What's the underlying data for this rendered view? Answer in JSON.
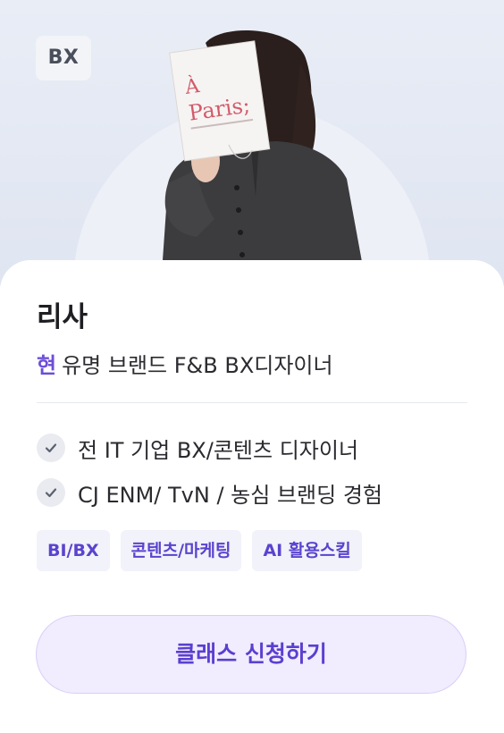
{
  "hero": {
    "badge": "BX",
    "book_title_line1": "À",
    "book_title_line2": "Paris;",
    "photo_icon": "person-holding-book"
  },
  "profile": {
    "name": "리사",
    "role_prefix": "현",
    "role": "유명 브랜드 F&B BX디자이너",
    "career": [
      "전 IT 기업 BX/콘텐츠 디자이너",
      "CJ ENM/ TvN / 농심 브랜딩 경험"
    ],
    "career_icon": "check-icon"
  },
  "tags": [
    "BI/BX",
    "콘텐츠/마케팅",
    "AI 활용스킬"
  ],
  "cta": {
    "label": "클래스 신청하기"
  },
  "colors": {
    "accent": "#5b3fd0",
    "cta_bg": "#f1ecfe",
    "tag_bg": "#f1f2fa",
    "hero_bg": "#e9edf6"
  }
}
